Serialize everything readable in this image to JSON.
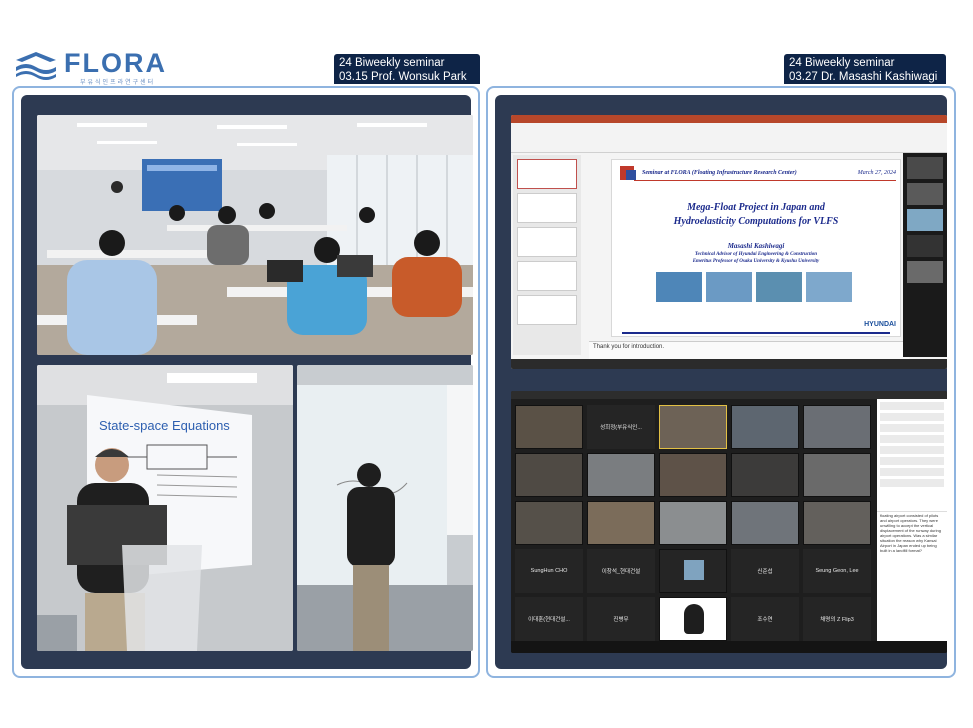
{
  "logo": {
    "name": "FLORA",
    "subtitle": "부유식인프라연구센터"
  },
  "left_tag": {
    "line1": "24 Biweekly seminar",
    "line2": "03.15 Prof. Wonsuk Park"
  },
  "right_tag": {
    "line1": "24 Biweekly seminar",
    "line2": "03.27 Dr. Masashi Kashiwagi"
  },
  "lecture_slide": {
    "title": "State-space Equations"
  },
  "ppt": {
    "header": "Seminar at FLORA (Floating Infrastructure Research Center)",
    "date": "March 27, 2024",
    "title_line1": "Mega-Float Project in Japan and",
    "title_line2": "Hydroelasticity Computations for VLFS",
    "presenter": "Masashi Kashiwagi",
    "role1": "Technical Advisor of Hyundai Engineering & Construction",
    "role2": "Emeritus Professor of Osaka University & Kyushu University",
    "brand": "HYUNDAI",
    "notes": "Thank you for introduction."
  },
  "zoom": {
    "named_tiles": [
      {
        "name": "SungHun CHO"
      },
      {
        "name": "이창석_현대건설"
      },
      {
        "name": "신준섭"
      },
      {
        "name": "Seung Geon, Lee"
      },
      {
        "name": "이대훈(현대건설..."
      },
      {
        "name": "진병무"
      },
      {
        "name": "조수연"
      },
      {
        "name": "채명의 Z Flip3"
      },
      {
        "name": "성희정(부유식인..."
      }
    ],
    "chat_message": "floating airport consisted of pilots and airport operators. They were unwilling to accept the vertical displacement of the runway during airport operations. Was a similar situation the reason why Kansai Airport in Japan ended up being built in a landfill format?"
  }
}
